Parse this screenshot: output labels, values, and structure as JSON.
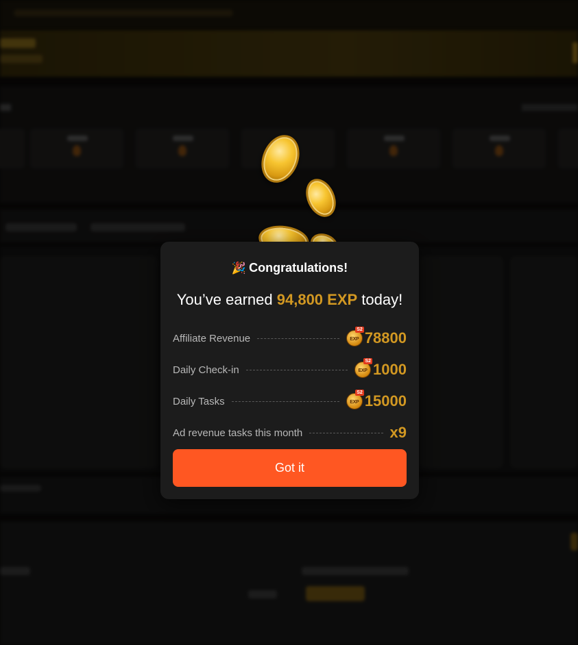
{
  "modal": {
    "title": "Congratulations!",
    "headline_prefix": "You’ve earned ",
    "headline_amount": "94,800 EXP",
    "headline_suffix": " today!",
    "badge_text": "EXP",
    "badge_tag": "S2",
    "rows": [
      {
        "label": "Affiliate Revenue",
        "value": "78800",
        "icon": "exp-s2-coin-icon"
      },
      {
        "label": "Daily Check-in",
        "value": "1000",
        "icon": "exp-s2-coin-icon"
      },
      {
        "label": "Daily Tasks",
        "value": "15000",
        "icon": "exp-s2-coin-icon"
      },
      {
        "label": "Ad revenue tasks this month",
        "value": "x9",
        "icon": null
      }
    ],
    "button_label": "Got it"
  },
  "colors": {
    "accent_gold": "#d29822",
    "button_orange": "#ff5722",
    "modal_bg": "#1c1c1c"
  }
}
